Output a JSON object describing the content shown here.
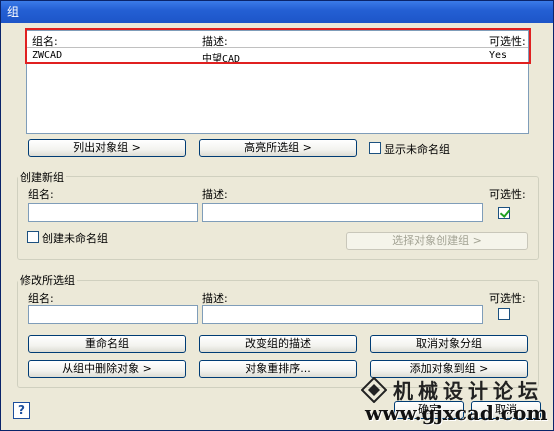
{
  "window": {
    "title": "组"
  },
  "group_list": {
    "headers": {
      "name": "组名:",
      "description": "描述:",
      "selectable": "可选性:"
    },
    "rows": [
      {
        "name": "ZWCAD",
        "description": "中望CAD",
        "selectable": "Yes"
      }
    ]
  },
  "list_buttons": {
    "list_objects": "列出对象组  >",
    "highlight": "高亮所选组  >",
    "show_unnamed": "显示未命名组"
  },
  "create_group": {
    "legend": "创建新组",
    "name_label": "组名:",
    "description_label": "描述:",
    "selectable_label": "可选性:",
    "unnamed_label": "创建未命名组",
    "create_button": "选择对象创建组  >"
  },
  "modify_group": {
    "legend": "修改所选组",
    "name_label": "组名:",
    "description_label": "描述:",
    "selectable_label": "可选性:",
    "rename": "重命名组",
    "change_description": "改变组的描述",
    "ungroup": "取消对象分组",
    "remove_objects": "从组中删除对象  >",
    "reorder": "对象重排序...",
    "add_objects": "添加对象到组  >"
  },
  "footer": {
    "help": "?",
    "ok": "确定",
    "cancel": "取消"
  },
  "watermark": {
    "line1": "机械设计论坛",
    "line2": "www.gjxcad.com"
  }
}
